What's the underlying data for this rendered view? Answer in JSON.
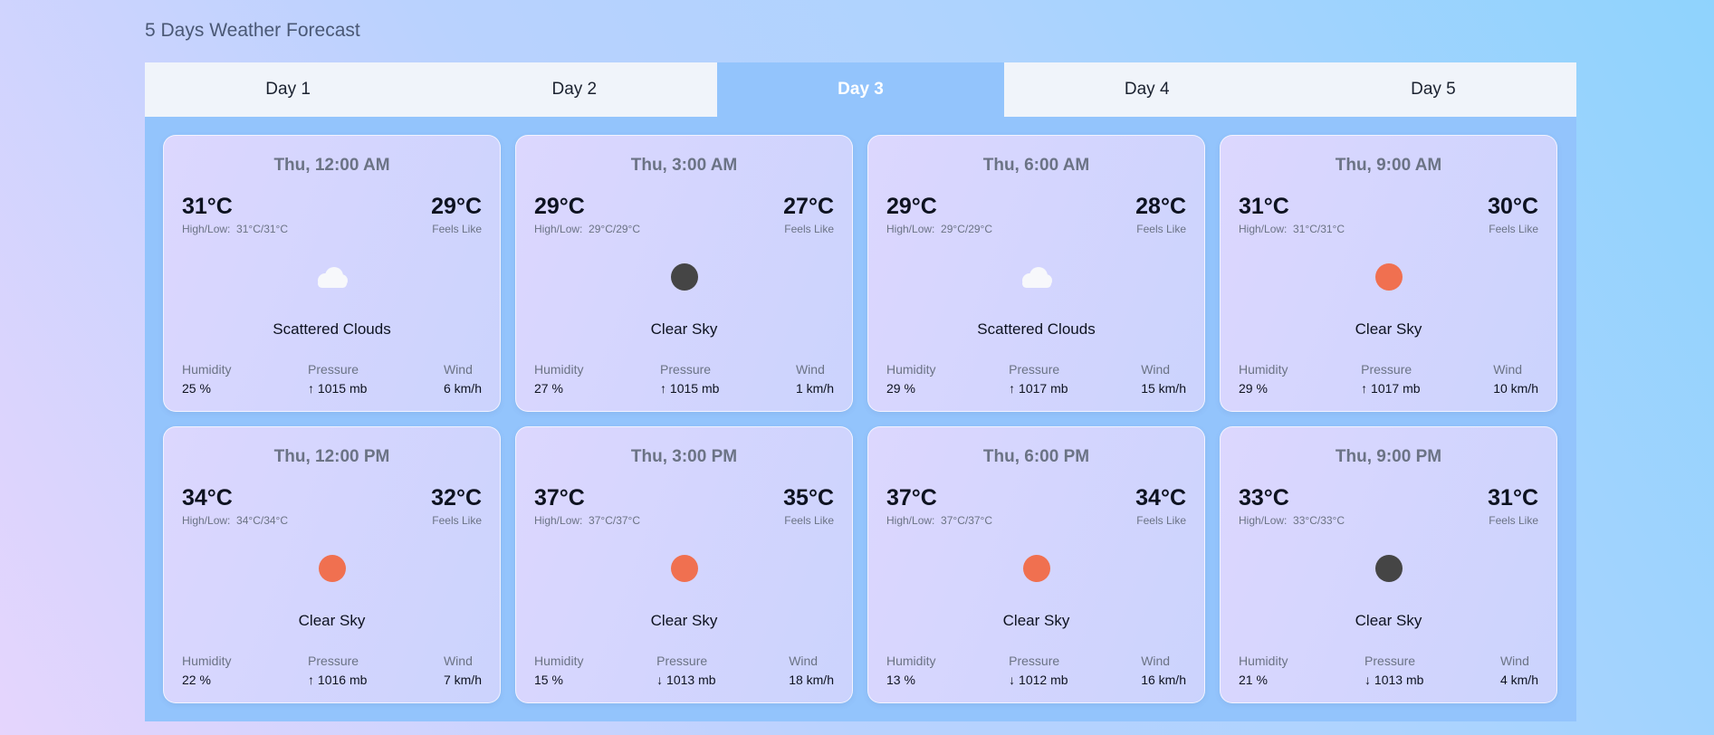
{
  "page_title": "5 Days Weather Forecast",
  "tabs": [
    {
      "label": "Day 1",
      "active": false
    },
    {
      "label": "Day 2",
      "active": false
    },
    {
      "label": "Day 3",
      "active": true
    },
    {
      "label": "Day 4",
      "active": false
    },
    {
      "label": "Day 5",
      "active": false
    }
  ],
  "labels": {
    "high_low": "High/Low:",
    "feels_like": "Feels Like",
    "humidity": "Humidity",
    "pressure": "Pressure",
    "wind": "Wind"
  },
  "colors": {
    "sun": "#f07050",
    "moon": "#454545",
    "active_tab": "#93c4fc"
  },
  "cards": [
    {
      "time": "Thu, 12:00 AM",
      "temp": "31°C",
      "high_low": "31°C/31°C",
      "feels": "29°C",
      "icon": "cloud-icon",
      "desc": "Scattered Clouds",
      "humidity": "25 %",
      "pressure": "↑ 1015 mb",
      "wind": "6 km/h"
    },
    {
      "time": "Thu, 3:00 AM",
      "temp": "29°C",
      "high_low": "29°C/29°C",
      "feels": "27°C",
      "icon": "moon-icon",
      "desc": "Clear Sky",
      "humidity": "27 %",
      "pressure": "↑ 1015 mb",
      "wind": "1 km/h"
    },
    {
      "time": "Thu, 6:00 AM",
      "temp": "29°C",
      "high_low": "29°C/29°C",
      "feels": "28°C",
      "icon": "cloud-icon",
      "desc": "Scattered Clouds",
      "humidity": "29 %",
      "pressure": "↑ 1017 mb",
      "wind": "15 km/h"
    },
    {
      "time": "Thu, 9:00 AM",
      "temp": "31°C",
      "high_low": "31°C/31°C",
      "feels": "30°C",
      "icon": "sun-icon",
      "desc": "Clear Sky",
      "humidity": "29 %",
      "pressure": "↑ 1017 mb",
      "wind": "10 km/h"
    },
    {
      "time": "Thu, 12:00 PM",
      "temp": "34°C",
      "high_low": "34°C/34°C",
      "feels": "32°C",
      "icon": "sun-icon",
      "desc": "Clear Sky",
      "humidity": "22 %",
      "pressure": "↑ 1016 mb",
      "wind": "7 km/h"
    },
    {
      "time": "Thu, 3:00 PM",
      "temp": "37°C",
      "high_low": "37°C/37°C",
      "feels": "35°C",
      "icon": "sun-icon",
      "desc": "Clear Sky",
      "humidity": "15 %",
      "pressure": "↓ 1013 mb",
      "wind": "18 km/h"
    },
    {
      "time": "Thu, 6:00 PM",
      "temp": "37°C",
      "high_low": "37°C/37°C",
      "feels": "34°C",
      "icon": "sun-icon",
      "desc": "Clear Sky",
      "humidity": "13 %",
      "pressure": "↓ 1012 mb",
      "wind": "16 km/h"
    },
    {
      "time": "Thu, 9:00 PM",
      "temp": "33°C",
      "high_low": "33°C/33°C",
      "feels": "31°C",
      "icon": "moon-icon",
      "desc": "Clear Sky",
      "humidity": "21 %",
      "pressure": "↓ 1013 mb",
      "wind": "4 km/h"
    }
  ]
}
